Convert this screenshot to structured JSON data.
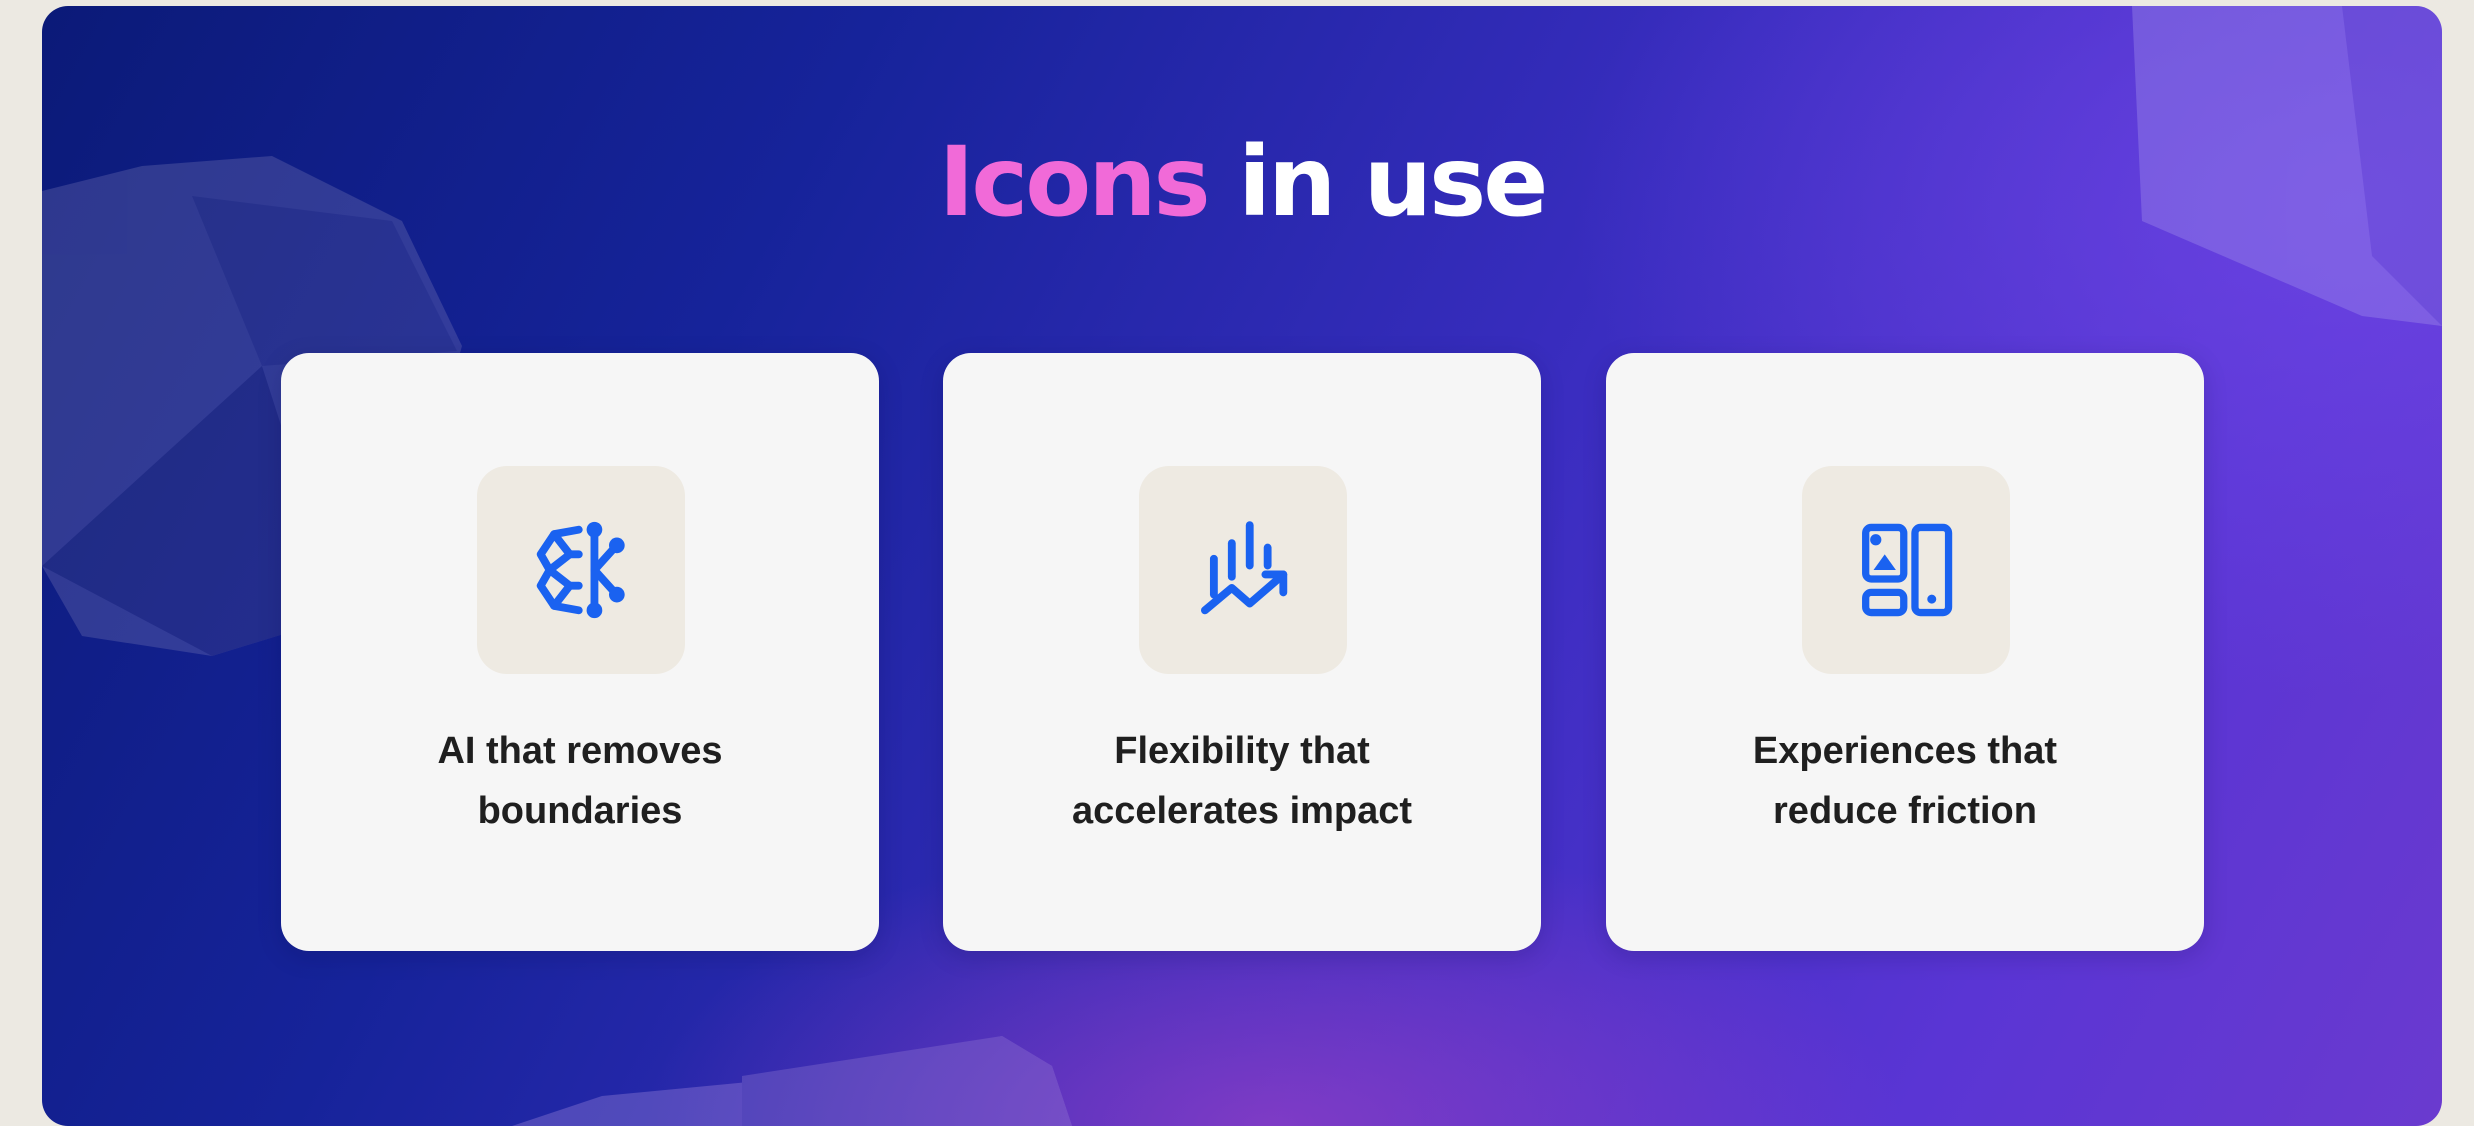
{
  "title": {
    "accent": "Icons",
    "rest": "in use"
  },
  "cards": [
    {
      "icon": "ai-network-icon",
      "line1": "AI that removes",
      "line2": "boundaries"
    },
    {
      "icon": "growth-chart-icon",
      "line1": "Flexibility that",
      "line2": "accelerates impact"
    },
    {
      "icon": "devices-icon",
      "line1": "Experiences that",
      "line2": "reduce friction"
    }
  ],
  "colors": {
    "accent": "#f16ad8",
    "icon_blue": "#1a62f0",
    "card_bg": "#f6f6f6",
    "icon_tile_bg": "#eeeae2",
    "text": "#1f1f1f"
  }
}
